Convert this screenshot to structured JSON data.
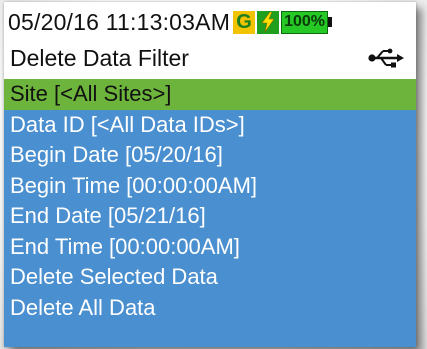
{
  "status": {
    "date": "05/20/16",
    "time": "11:13:03AM",
    "gps_badge": "G",
    "battery_level": "100%",
    "icons": [
      "gps-badge-icon",
      "charging-bolt-icon",
      "battery-icon"
    ]
  },
  "header": {
    "title": "Delete Data Filter",
    "connection_icon": "usb-icon"
  },
  "menu": {
    "items": [
      {
        "label": "Site [<All Sites>]",
        "selected": true
      },
      {
        "label": "Data ID [<All Data IDs>]",
        "selected": false
      },
      {
        "label": "Begin Date [05/20/16]",
        "selected": false
      },
      {
        "label": "Begin Time [00:00:00AM]",
        "selected": false
      },
      {
        "label": "End Date [05/21/16]",
        "selected": false
      },
      {
        "label": "End Time [00:00:00AM]",
        "selected": false
      },
      {
        "label": "Delete Selected Data",
        "selected": false
      },
      {
        "label": "Delete All Data",
        "selected": false
      }
    ]
  },
  "colors": {
    "background": "#4a8fcf",
    "selected_row": "#6cb43c",
    "header": "#ffffff",
    "gps_badge": "#f2c300",
    "charging_badge": "#1ea01e",
    "battery_fill": "#26c826"
  }
}
